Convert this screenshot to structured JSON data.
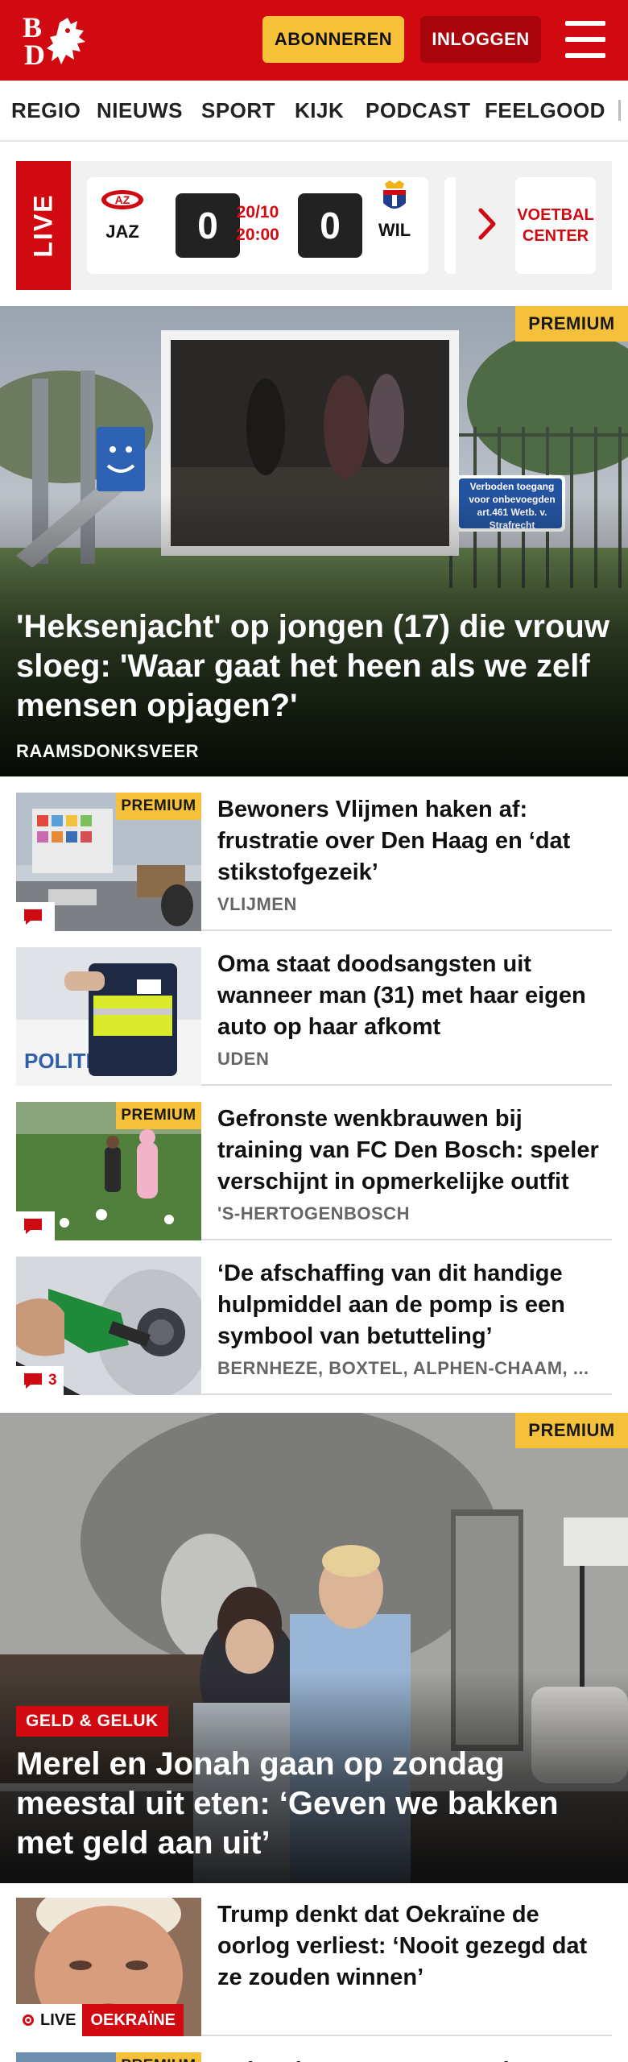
{
  "header": {
    "logo_text": "BD",
    "subscribe_label": "ABONNEREN",
    "login_label": "INLOGGEN",
    "menu_icon": "hamburger-menu-icon",
    "brand_color": "#d10a11"
  },
  "nav": {
    "items": [
      "REGIO",
      "NIEUWS",
      "SPORT",
      "KIJK",
      "PODCAST",
      "FEELGOOD"
    ]
  },
  "live": {
    "tab_label": "LIVE",
    "match": {
      "home_team": "JAZ",
      "away_team": "WIL",
      "home_score": "0",
      "away_score": "0",
      "date": "20/10",
      "time": "20:00"
    },
    "center_label": "VOETBAL CENTER"
  },
  "hero1": {
    "premium": "PREMIUM",
    "title": "'Heksenjacht' op jongen (17) die vrouw sloeg: 'Waar gaat het heen als we zelf mensen opjagen?'",
    "location": "RAAMSDONKSVEER",
    "sign_text": "Verboden toegang voor onbevoegden art.461 Wetb. v. Strafrecht"
  },
  "articles": [
    {
      "premium": "PREMIUM",
      "title": "Bewoners Vlijmen haken af: frustratie over Den Haag en ‘dat stikstofgezeik’",
      "location": "VLIJMEN",
      "comments": ""
    },
    {
      "title": "Oma staat doodsangsten uit wanneer man (31) met haar eigen auto op haar afkomt",
      "location": "UDEN"
    },
    {
      "premium": "PREMIUM",
      "title": "Gefronste wenkbrauwen bij training van FC Den Bosch: speler verschijnt in opmerkelijke outfit",
      "location": "'S-HERTOGENBOSCH",
      "comments": ""
    },
    {
      "title": "‘De afschaffing van dit handige hulpmiddel aan de pomp is een symbool van betutteling’",
      "location": "BERNHEZE, BOXTEL, ALPHEN-CHAAM, ...",
      "comments": "3"
    }
  ],
  "hero2": {
    "premium": "PREMIUM",
    "category": "GELD & GELUK",
    "title": "Merel en Jonah gaan op zondag meestal uit eten: ‘Geven we bakken met geld aan uit’"
  },
  "article_trump": {
    "title": "Trump denkt dat Oekraïne de oorlog verliest: ‘Nooit gezegd dat ze zouden winnen’",
    "live_label": "LIVE",
    "tag": "OEKRAÏNE"
  },
  "partial_next": {
    "premium": "PREMIUM",
    "title": "Bekende namen voor sterke"
  }
}
